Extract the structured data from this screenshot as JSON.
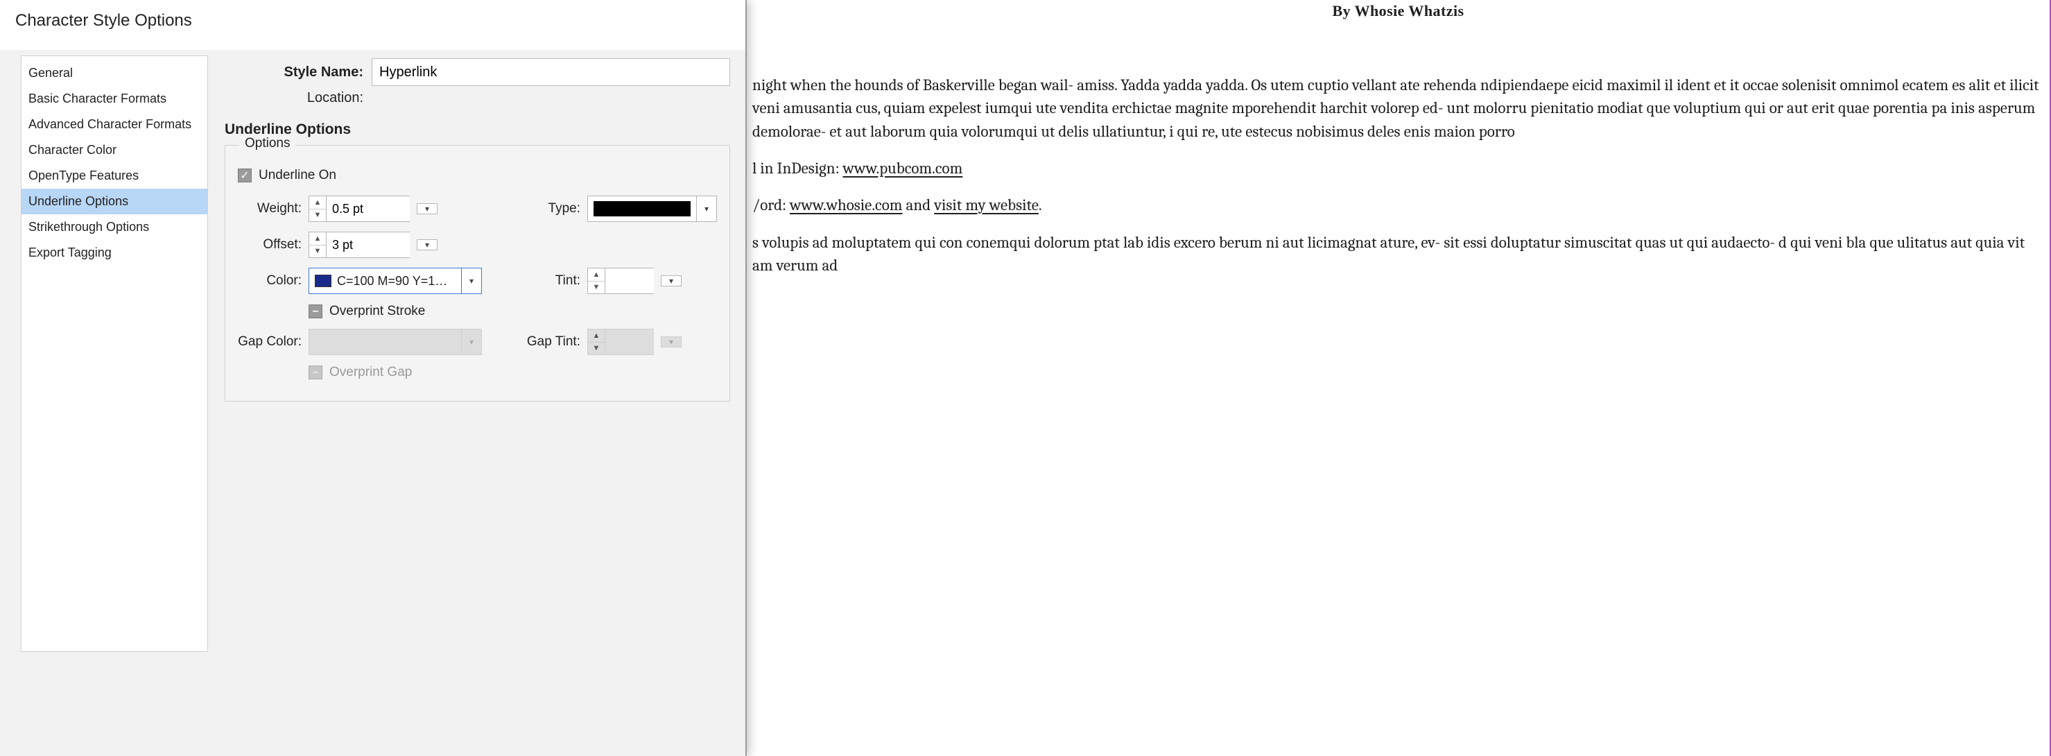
{
  "dialog": {
    "title": "Character Style Options",
    "categories": [
      {
        "label": "General",
        "selected": false
      },
      {
        "label": "Basic Character Formats",
        "selected": false
      },
      {
        "label": "Advanced Character Formats",
        "selected": false
      },
      {
        "label": "Character Color",
        "selected": false
      },
      {
        "label": "OpenType Features",
        "selected": false
      },
      {
        "label": "Underline Options",
        "selected": true
      },
      {
        "label": "Strikethrough Options",
        "selected": false
      },
      {
        "label": "Export Tagging",
        "selected": false
      }
    ],
    "style_name_label": "Style Name:",
    "style_name_value": "Hyperlink",
    "location_label": "Location:",
    "section_heading": "Underline Options",
    "fieldset_legend": "Options",
    "underline_on_label": "Underline On",
    "underline_on_checked": true,
    "weight_label": "Weight:",
    "weight_value": "0.5 pt",
    "type_label": "Type:",
    "type_value": "solid",
    "offset_label": "Offset:",
    "offset_value": "3 pt",
    "color_label": "Color:",
    "color_value_text": "C=100 M=90 Y=1…",
    "color_swatch_hex": "#1a2a8b",
    "tint_label": "Tint:",
    "tint_value": "",
    "overprint_stroke_label": "Overprint Stroke",
    "gap_color_label": "Gap Color:",
    "gap_tint_label": "Gap Tint:",
    "overprint_gap_label": "Overprint Gap"
  },
  "document": {
    "byline": "By Whosie Whatzis",
    "body1": "night when the hounds of Baskerville began wail- amiss. Yadda yadda yadda. Os utem cuptio vellant ate rehenda ndipiendaepe eicid maximil il ident et it occae solenisit omnimol ecatem es alit et ilicit veni amusantia cus, quiam expelest iumqui ute vendita erchictae magnite mporehendit harchit volorep ed- unt molorru pienitatio modiat que voluptium qui or aut erit quae porentia pa inis asperum demolorae- et aut laborum quia volorumqui ut delis ullatiuntur, i qui re, ute estecus nobisimus deles enis maion porro",
    "line2_prefix": "l in InDesign: ",
    "link1_text": "www.pubcom.com",
    "line3_prefix": "/ord: ",
    "link2_text": "www.whosie.com",
    "line3_mid": " and ",
    "link3_text": "visit my website",
    "line3_suffix": ".",
    "body2": "s volupis ad moluptatem qui con conemqui dolorum ptat lab idis excero berum ni aut licimagnat ature, ev- sit essi doluptatur simuscitat quas ut qui audaecto- d qui veni bla que ulitatus aut quia vit am verum ad"
  }
}
